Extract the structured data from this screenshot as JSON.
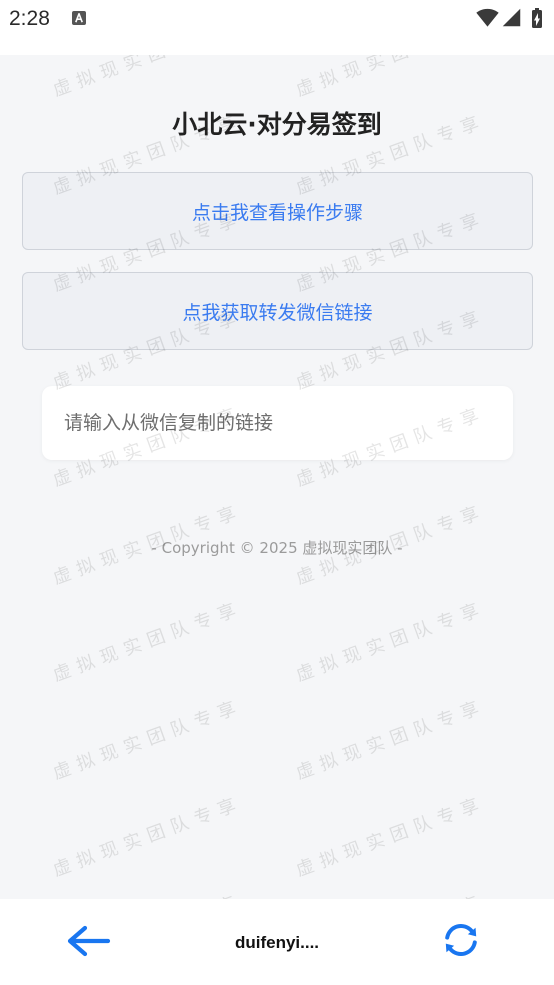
{
  "status_bar": {
    "time": "2:28",
    "icons": [
      "app-notification-icon",
      "wifi-icon",
      "signal-icon",
      "battery-charging-icon"
    ]
  },
  "page": {
    "title": "小北云·对分易签到",
    "buttons": [
      {
        "label": "点击我查看操作步骤"
      },
      {
        "label": "点我获取转发微信链接"
      }
    ],
    "link_input": {
      "value": "",
      "placeholder": "请输入从微信复制的链接"
    },
    "copyright": "- Copyright © 2025 虚拟现实团队 -"
  },
  "watermark": {
    "text": "虚拟现实团队专享"
  },
  "bottom_bar": {
    "back_icon": "arrow-left-icon",
    "title": "duifenyi....",
    "refresh_icon": "refresh-icon"
  },
  "colors": {
    "page_background": "#f5f6f8",
    "button_background": "#eef0f4",
    "button_text": "#3a7bf0",
    "nav_icon": "#1976f0"
  }
}
